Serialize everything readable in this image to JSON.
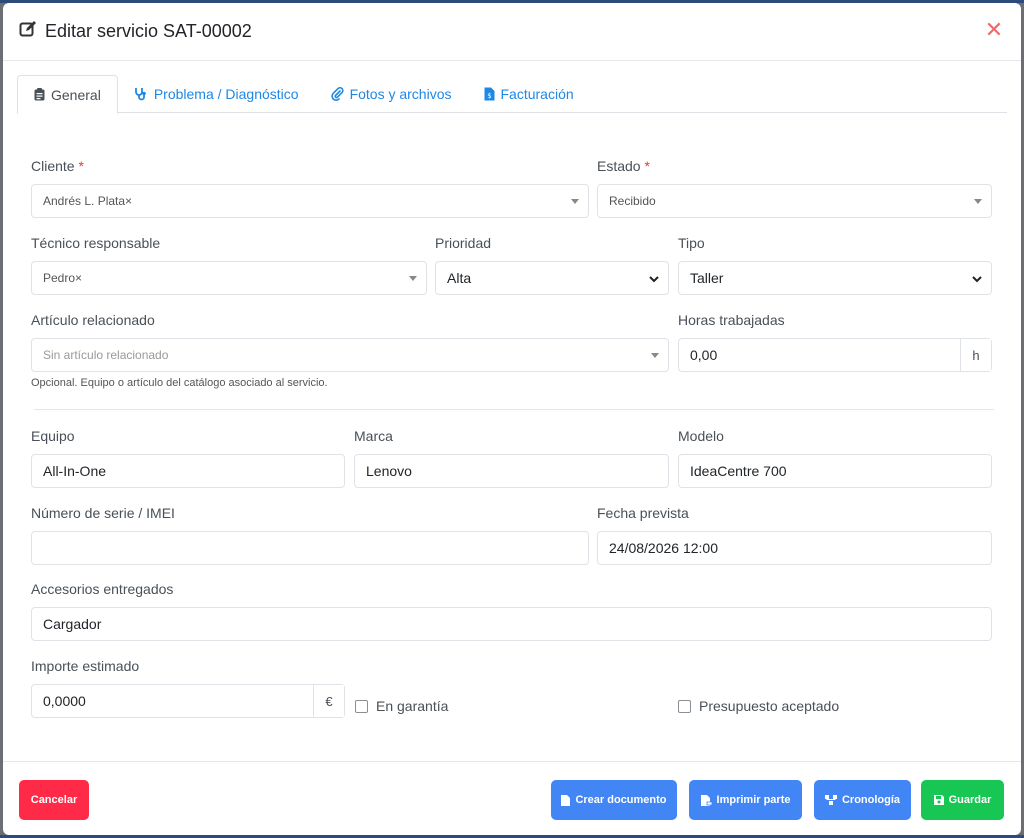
{
  "modal": {
    "title": "Editar servicio SAT-00002"
  },
  "tabs": [
    {
      "label": "General"
    },
    {
      "label": "Problema / Diagnóstico"
    },
    {
      "label": "Fotos y archivos"
    },
    {
      "label": "Facturación"
    }
  ],
  "form": {
    "cliente": {
      "label": "Cliente",
      "required": "*",
      "value": "Andrés L. Plata×"
    },
    "estado": {
      "label": "Estado",
      "required": "*",
      "value": "Recibido"
    },
    "tecnico": {
      "label": "Técnico responsable",
      "value": "Pedro×"
    },
    "prioridad": {
      "label": "Prioridad",
      "value": "Alta"
    },
    "tipo": {
      "label": "Tipo",
      "value": "Taller"
    },
    "articulo": {
      "label": "Artículo relacionado",
      "placeholder": "Sin artículo relacionado",
      "help": "Opcional. Equipo o artículo del catálogo asociado al servicio."
    },
    "horas": {
      "label": "Horas trabajadas",
      "value": "0,00",
      "unit": "h"
    },
    "equipo": {
      "label": "Equipo",
      "value": "All-In-One"
    },
    "marca": {
      "label": "Marca",
      "value": "Lenovo"
    },
    "modelo": {
      "label": "Modelo",
      "value": "IdeaCentre 700"
    },
    "serie": {
      "label": "Número de serie / IMEI",
      "value": ""
    },
    "fecha": {
      "label": "Fecha prevista",
      "value": "24/08/2026 12:00"
    },
    "accesorios": {
      "label": "Accesorios entregados",
      "value": "Cargador"
    },
    "importe": {
      "label": "Importe estimado",
      "value": "0,0000",
      "unit": "€"
    },
    "garantia": {
      "label": "En garantía",
      "checked": false
    },
    "presupuesto": {
      "label": "Presupuesto aceptado",
      "checked": false
    }
  },
  "footer": {
    "cancel": "Cancelar",
    "crear": "Crear documento",
    "imprimir": "Imprimir parte",
    "cronologia": "Cronología",
    "guardar": "Guardar"
  },
  "colors": {
    "accent_blue": "#4285f4",
    "tab_link": "#1e88e5",
    "danger": "#ff2a47",
    "success": "#17c653",
    "close": "#f06a6a"
  }
}
